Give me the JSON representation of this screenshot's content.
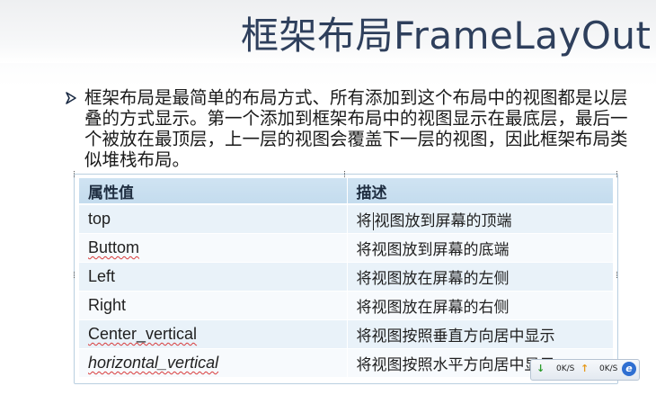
{
  "slide": {
    "title": "框架布局FrameLayOut",
    "bullet": "框架布局是最简单的布局方式、所有添加到这个布局中的视图都是以层叠的方式显示。第一个添加到框架布局中的视图显示在最底层，最后一个被放在最顶层，上一层的视图会覆盖下一层的视图，因此框架布局类似堆栈布局。",
    "bullet_icon": "arrow-bullet-icon"
  },
  "table": {
    "headers": [
      "属性值",
      "描述"
    ],
    "rows": [
      {
        "attr": "top",
        "desc": "将视图放到屏幕的顶端"
      },
      {
        "attr": "Buttom",
        "desc": "将视图放到屏幕的底端"
      },
      {
        "attr": "Left",
        "desc": "将视图放在屏幕的左侧"
      },
      {
        "attr": "Right",
        "desc": "将视图放在屏幕的右侧"
      },
      {
        "attr": "Center_vertical",
        "desc": "将视图按照垂直方向居中显示"
      },
      {
        "attr": "horizontal_vertical",
        "desc": "将视图按照水平方向居中显示"
      }
    ]
  },
  "net_monitor": {
    "download": "0K/S",
    "upload": "0K/S",
    "download_icon": "down-arrow-icon",
    "upload_icon": "up-arrow-icon",
    "browser_icon": "ie-browser-icon"
  },
  "colors": {
    "title": "#2e3f5c",
    "header_row": "#c4dcee",
    "row_odd": "#e9f2f9",
    "row_even": "#f7fafd",
    "frame_border": "#b9cfe0"
  }
}
